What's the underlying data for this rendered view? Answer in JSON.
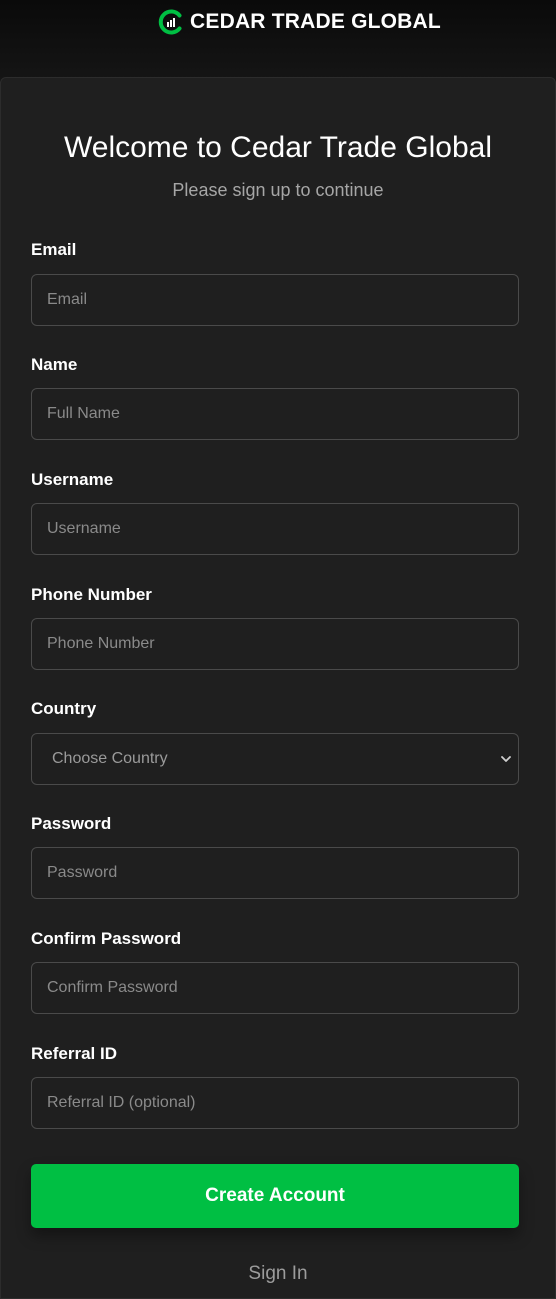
{
  "header": {
    "brand_name": "CEDAR TRADE GLOBAL",
    "logo_icon": "chart-circle-logo",
    "accent_color": "#00bf43"
  },
  "form": {
    "title": "Welcome to Cedar Trade Global",
    "subtitle": "Please sign up to continue",
    "fields": {
      "email": {
        "label": "Email",
        "placeholder": "Email"
      },
      "name": {
        "label": "Name",
        "placeholder": "Full Name"
      },
      "username": {
        "label": "Username",
        "placeholder": "Username"
      },
      "phone": {
        "label": "Phone Number",
        "placeholder": "Phone Number"
      },
      "country": {
        "label": "Country",
        "selected": "Choose Country",
        "icon": "chevron-down-icon"
      },
      "password": {
        "label": "Password",
        "placeholder": "Password"
      },
      "confirm_password": {
        "label": "Confirm Password",
        "placeholder": "Confirm Password"
      },
      "referral": {
        "label": "Referral ID",
        "placeholder": "Referral ID (optional)"
      }
    },
    "submit_label": "Create Account",
    "signin_label": "Sign In"
  }
}
